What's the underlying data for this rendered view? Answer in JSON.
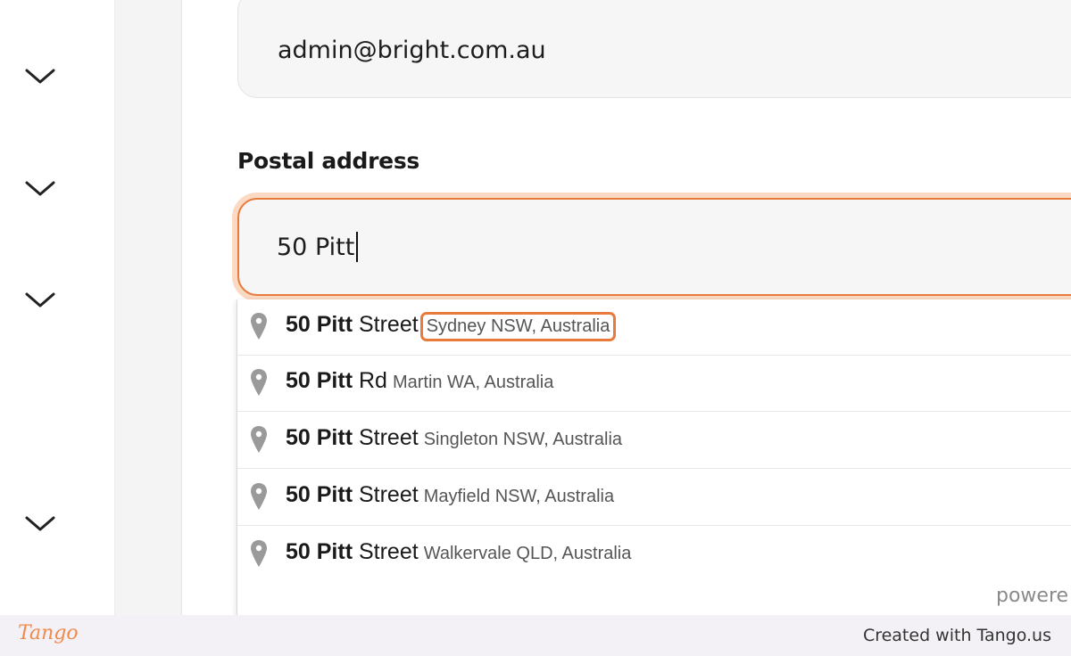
{
  "email": {
    "value": "admin@bright.com.au"
  },
  "postal": {
    "label": "Postal address",
    "value": "50 Pitt"
  },
  "suggestions": [
    {
      "main_bold": "50 Pitt",
      "main_rest": " Street",
      "secondary": "Sydney NSW, Australia",
      "highlighted": true
    },
    {
      "main_bold": "50 Pitt",
      "main_rest": " Rd",
      "secondary": "Martin WA, Australia",
      "highlighted": false
    },
    {
      "main_bold": "50 Pitt",
      "main_rest": " Street",
      "secondary": "Singleton NSW, Australia",
      "highlighted": false
    },
    {
      "main_bold": "50 Pitt",
      "main_rest": " Street",
      "secondary": "Mayfield NSW, Australia",
      "highlighted": false
    },
    {
      "main_bold": "50 Pitt",
      "main_rest": " Street",
      "secondary": "Walkervale QLD, Australia",
      "highlighted": false
    }
  ],
  "dropdown_footer": "powere",
  "footer": {
    "logo": "Tango",
    "created": "Created with Tango.us"
  },
  "colors": {
    "accent": "#e87a3c",
    "accent_glow": "#fbd9c3",
    "field_bg": "#f6f6f6",
    "footer_bg": "#f3f1f6",
    "logo": "#f08a4b"
  },
  "icons": {
    "chevron": "chevron-down-icon",
    "pin": "map-pin-icon"
  }
}
